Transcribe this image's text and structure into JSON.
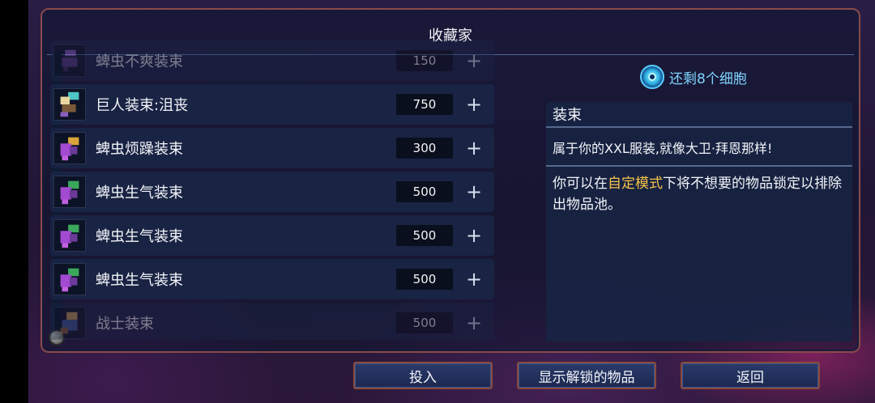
{
  "panel": {
    "title": "收藏家"
  },
  "items": [
    {
      "name": "蜱虫不爽装束",
      "cost": "150",
      "faded": true
    },
    {
      "name": "巨人装束:沮丧",
      "cost": "750",
      "faded": false
    },
    {
      "name": "蜱虫烦躁装束",
      "cost": "300",
      "faded": false
    },
    {
      "name": "蜱虫生气装束",
      "cost": "500",
      "faded": false
    },
    {
      "name": "蜱虫生气装束",
      "cost": "500",
      "faded": false
    },
    {
      "name": "蜱虫生气装束",
      "cost": "500",
      "faded": false
    },
    {
      "name": "战士装束",
      "cost": "500",
      "faded": true
    }
  ],
  "plus_label": "+",
  "cells": {
    "text": "还剩8个细胞"
  },
  "description": {
    "title": "装束",
    "flavor": "属于你的XXL服装,就像大卫·拜恩那样!",
    "body_prefix": "你可以在",
    "body_highlight": "自定模式",
    "body_suffix": "下将不想要的物品锁定以排除出物品池。",
    "highlight_color": "#f5c24a"
  },
  "buttons": {
    "invest": "投入",
    "show_unlocked": "显示解锁的物品",
    "back": "返回"
  },
  "icons": [
    "cell-icon",
    "outfit-icon",
    "plus-icon",
    "scroll-knob"
  ]
}
